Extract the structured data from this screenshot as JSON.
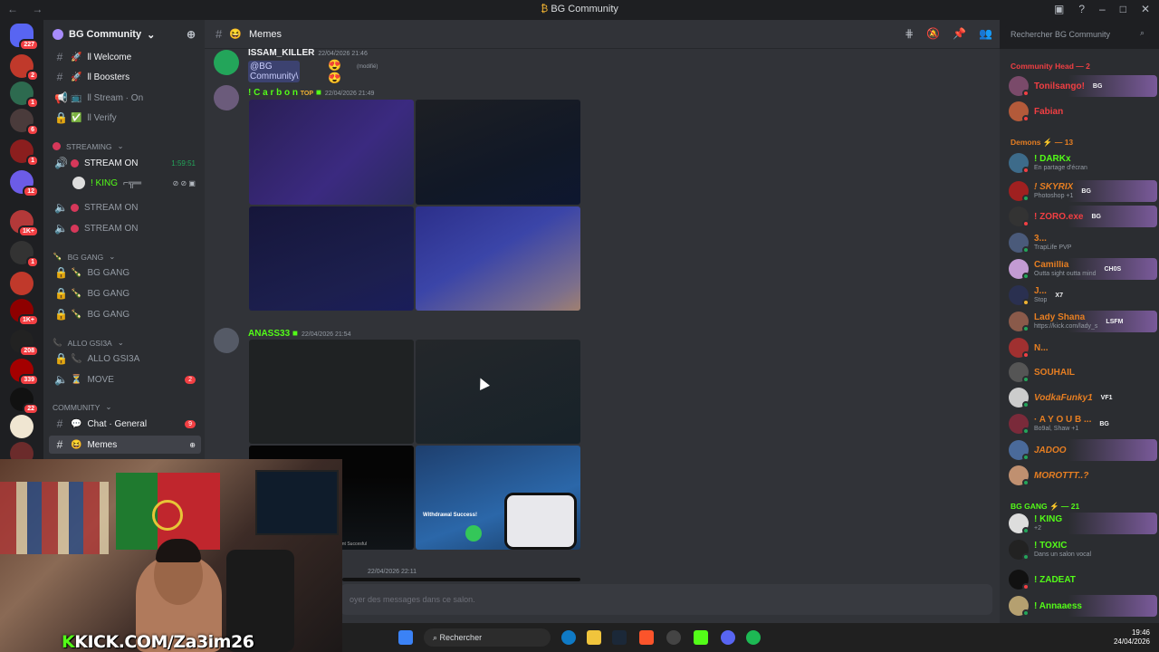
{
  "window": {
    "title": "BG Community",
    "title_icon": "₿"
  },
  "guild": {
    "name": "BG Community"
  },
  "rail_badges": [
    "227",
    "2",
    "1",
    "6",
    "1",
    "12",
    "1K+",
    "1",
    "1K+",
    "208",
    "339",
    "22"
  ],
  "channels": {
    "welcome": "ll Welcome",
    "boosters": "ll Boosters",
    "stream": "ll Stream · On",
    "verify": "ll Verify",
    "cat_streaming": "STREAMING",
    "stream_on_1": "STREAM ON",
    "stream_timer": "1:59:51",
    "king": "! KING",
    "stream_on_2": "STREAM ON",
    "stream_on_3": "STREAM ON",
    "cat_bggang": "BG GANG",
    "bg_gang_1": "BG GANG",
    "bg_gang_2": "BG GANG",
    "bg_gang_3": "BG GANG",
    "cat_allo": "ALLO GSI3A",
    "allo": "ALLO GSI3A",
    "move": "MOVE",
    "move_badge": "2",
    "cat_community": "COMMUNITY",
    "chat_general": "Chat · General",
    "chat_badge": "9",
    "memes": "Memes"
  },
  "header": {
    "channel": "Memes",
    "search_placeholder": "Rechercher BG Community"
  },
  "messages": [
    {
      "author": "ISSAM_KILLER",
      "time": "22/04/2026 21:46",
      "mention": "@BG Community\\",
      "edited": "(modifié)"
    },
    {
      "author": "! C a r b o n",
      "time": "22/04/2026 21:49",
      "badge": "TOP"
    },
    {
      "author": "ANASS33",
      "time": "22/04/2026 21:54"
    },
    {
      "time": "22/04/2026 22:11"
    }
  ],
  "image_texts": {
    "withdrawal": "Withdrawal Success!",
    "sent": "ent Succesful"
  },
  "chat_input_placeholder": "oyer des messages dans ce salon.",
  "members": {
    "cat_head": "Community Head — 2",
    "cat_demons": "Demons ⚡ — 13",
    "cat_bggang": "BG GANG ⚡ — 21",
    "list": [
      {
        "name": "Tonilsango!",
        "sub": "",
        "tag": "BG"
      },
      {
        "name": "Fabian",
        "sub": "",
        "tag": ""
      },
      {
        "name": "! DARKx",
        "sub": "En partage d'écran",
        "tag": ""
      },
      {
        "name": "! SKYRIX",
        "sub": "Photoshop +1",
        "tag": "BG"
      },
      {
        "name": "! ZORO.exe",
        "sub": "",
        "tag": "BG"
      },
      {
        "name": "3...",
        "sub": "TrapLife PVP",
        "tag": ""
      },
      {
        "name": "Camillia",
        "sub": "Outta sight outta mind",
        "tag": "CH0S"
      },
      {
        "name": "J...",
        "sub": "Stop",
        "tag": "X7"
      },
      {
        "name": "Lady Shana",
        "sub": "https://kick.com/lady_s",
        "tag": "LSFM"
      },
      {
        "name": "N...",
        "sub": "",
        "tag": ""
      },
      {
        "name": "SOUHAIL",
        "sub": "",
        "tag": ""
      },
      {
        "name": "VodkaFunky1",
        "sub": "",
        "tag": "VF1"
      },
      {
        "name": "· A Y O U B ...",
        "sub": "Bo9al, Shaw +1",
        "tag": "BG"
      },
      {
        "name": "JADOO",
        "sub": "",
        "tag": ""
      },
      {
        "name": "MOROTTT..?",
        "sub": "",
        "tag": ""
      },
      {
        "name": "! KING",
        "sub": "+2",
        "tag": ""
      },
      {
        "name": "! TOXIC",
        "sub": "Dans un salon vocal",
        "tag": ""
      },
      {
        "name": "! ZADEAT",
        "sub": "",
        "tag": ""
      },
      {
        "name": "! Annaaess",
        "sub": "",
        "tag": ""
      }
    ]
  },
  "stream_overlay": {
    "kick_prefix": "K",
    "kick_text": "KICK.COM/Za3im26"
  },
  "taskbar": {
    "search": "Rechercher",
    "time": "19:46",
    "date": "24/04/2026"
  },
  "colors": {
    "accent_green": "#53fc18",
    "brand": "#5865f2",
    "alert": "#f23f43"
  }
}
